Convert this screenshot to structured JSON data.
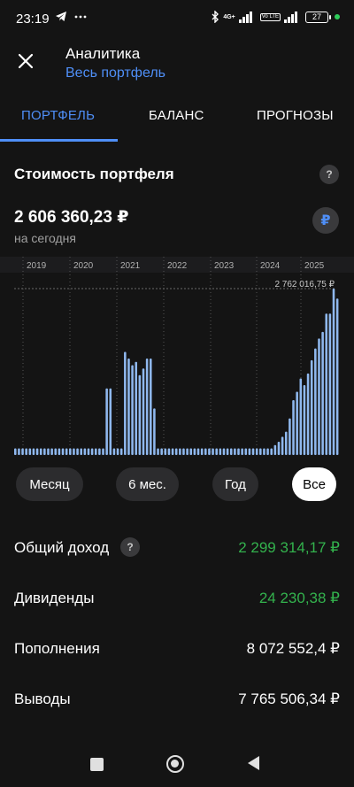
{
  "status_bar": {
    "time": "23:19",
    "battery": "27",
    "network_label": "4G+",
    "volte_label": "Vo LTE"
  },
  "header": {
    "title": "Аналитика",
    "subtitle": "Весь портфель"
  },
  "tabs": [
    {
      "label": "ПОРТФЕЛЬ",
      "active": true
    },
    {
      "label": "БАЛАНС",
      "active": false
    },
    {
      "label": "ПРОГНОЗЫ",
      "active": false
    }
  ],
  "portfolio": {
    "section_title": "Стоимость портфеля",
    "help_symbol": "?",
    "value": "2 606 360,23 ₽",
    "value_caption": "на сегодня",
    "currency_symbol": "₽"
  },
  "chart_data": {
    "type": "bar",
    "x_labels": [
      "2019",
      "2020",
      "2021",
      "2022",
      "2023",
      "2024",
      "2025"
    ],
    "annotation": "2 762 016,75 ₽",
    "max_value": 2762016.75,
    "bar_color": "#8fb8ee",
    "relative_values": [
      0.04,
      0.04,
      0.04,
      0.04,
      0.04,
      0.04,
      0.04,
      0.04,
      0.04,
      0.04,
      0.04,
      0.04,
      0.04,
      0.04,
      0.04,
      0.04,
      0.04,
      0.04,
      0.04,
      0.04,
      0.04,
      0.04,
      0.04,
      0.04,
      0.04,
      0.4,
      0.4,
      0.04,
      0.04,
      0.04,
      0.62,
      0.58,
      0.54,
      0.56,
      0.48,
      0.52,
      0.58,
      0.58,
      0.28,
      0.04,
      0.04,
      0.04,
      0.04,
      0.04,
      0.04,
      0.04,
      0.04,
      0.04,
      0.04,
      0.04,
      0.04,
      0.04,
      0.04,
      0.04,
      0.04,
      0.04,
      0.04,
      0.04,
      0.04,
      0.04,
      0.04,
      0.04,
      0.04,
      0.04,
      0.04,
      0.04,
      0.04,
      0.04,
      0.04,
      0.04,
      0.04,
      0.06,
      0.08,
      0.11,
      0.14,
      0.22,
      0.33,
      0.38,
      0.46,
      0.42,
      0.49,
      0.57,
      0.64,
      0.7,
      0.74,
      0.85,
      0.85,
      1.0,
      0.94
    ]
  },
  "periods": [
    {
      "label": "Месяц",
      "active": false
    },
    {
      "label": "6 мес.",
      "active": false
    },
    {
      "label": "Год",
      "active": false
    },
    {
      "label": "Все",
      "active": true
    }
  ],
  "stats": [
    {
      "label": "Общий доход",
      "value": "2 299 314,17 ₽",
      "color": "green",
      "help": true
    },
    {
      "label": "Дивиденды",
      "value": "24 230,38 ₽",
      "color": "green",
      "help": false
    },
    {
      "label": "Пополнения",
      "value": "8 072 552,4 ₽",
      "color": "white",
      "help": false
    },
    {
      "label": "Выводы",
      "value": "7 765 506,34 ₽",
      "color": "white",
      "help": false
    }
  ],
  "colors": {
    "accent": "#4f8ff7",
    "positive": "#33b24d",
    "background": "#141414"
  }
}
